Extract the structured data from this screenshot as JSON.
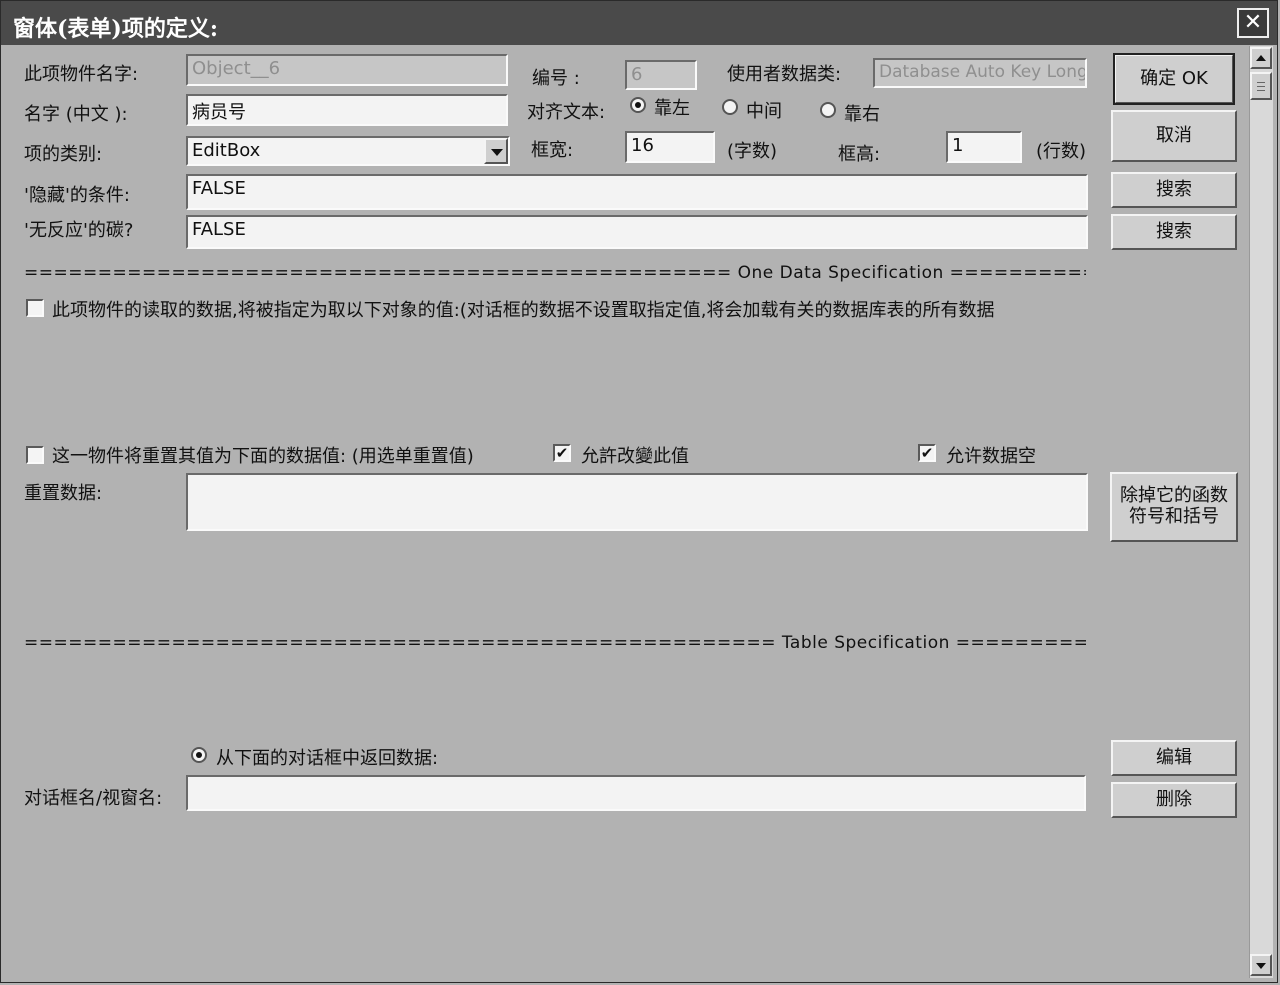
{
  "window": {
    "title": "窗体(表单)项的定义:",
    "close_label": "✕"
  },
  "fields": {
    "object_name_label": "此项物件名字:",
    "object_name_value": "Object__6",
    "number_label": "编号 :",
    "number_value": "6",
    "user_data_class_label": "使用者数据类:",
    "user_data_class_value": "Database Auto Key Long",
    "chinese_name_label": "名字 (中文 ):",
    "chinese_name_value": "病员号",
    "align_label": "对齐文本:",
    "align_options": [
      "靠左",
      "中间",
      "靠右"
    ],
    "align_selected": "靠左",
    "item_type_label": "项的类别:",
    "item_type_value": "EditBox",
    "box_width_label": "框宽:",
    "box_width_value": "16",
    "box_width_unit": "(字数)",
    "box_height_label": "框高:",
    "box_height_value": "1",
    "box_height_unit": "(行数)",
    "hide_condition_label": "'隐藏'的条件:",
    "hide_condition_value": "FALSE",
    "no_response_label": "'无反应'的碳?",
    "no_response_value": "FALSE"
  },
  "buttons": {
    "ok": "确定 OK",
    "cancel": "取消",
    "search1": "搜索",
    "search2": "搜索",
    "remove_function": "除掉它的函数 符号和括号",
    "edit": "编辑",
    "delete": "删除"
  },
  "one_data_section": {
    "separator": "================================================ One Data Specification ================================================",
    "read_data_checkbox_label": "此项物件的读取的数据,将被指定为取以下对象的值:(对话框的数据不设置取指定值,将会加载有关的数据库表的所有数据",
    "read_data_checked": false,
    "reset_checkbox_label": "这一物件将重置其值为下面的数据值: (用选单重置值)",
    "reset_checked": false,
    "allow_change_label": "允許改變此值",
    "allow_change_checked": true,
    "allow_empty_label": "允许数据空",
    "allow_empty_checked": true,
    "reset_data_label": "重置数据:",
    "reset_data_value": ""
  },
  "table_section": {
    "separator": "=================================================== Table Specification ===================================================",
    "return_radio_label": "从下面的对话框中返回数据:",
    "return_radio_selected": true,
    "dialog_name_label": "对话框名/视窗名:",
    "dialog_name_value": ""
  },
  "icons": {
    "check_mark": "✔"
  }
}
